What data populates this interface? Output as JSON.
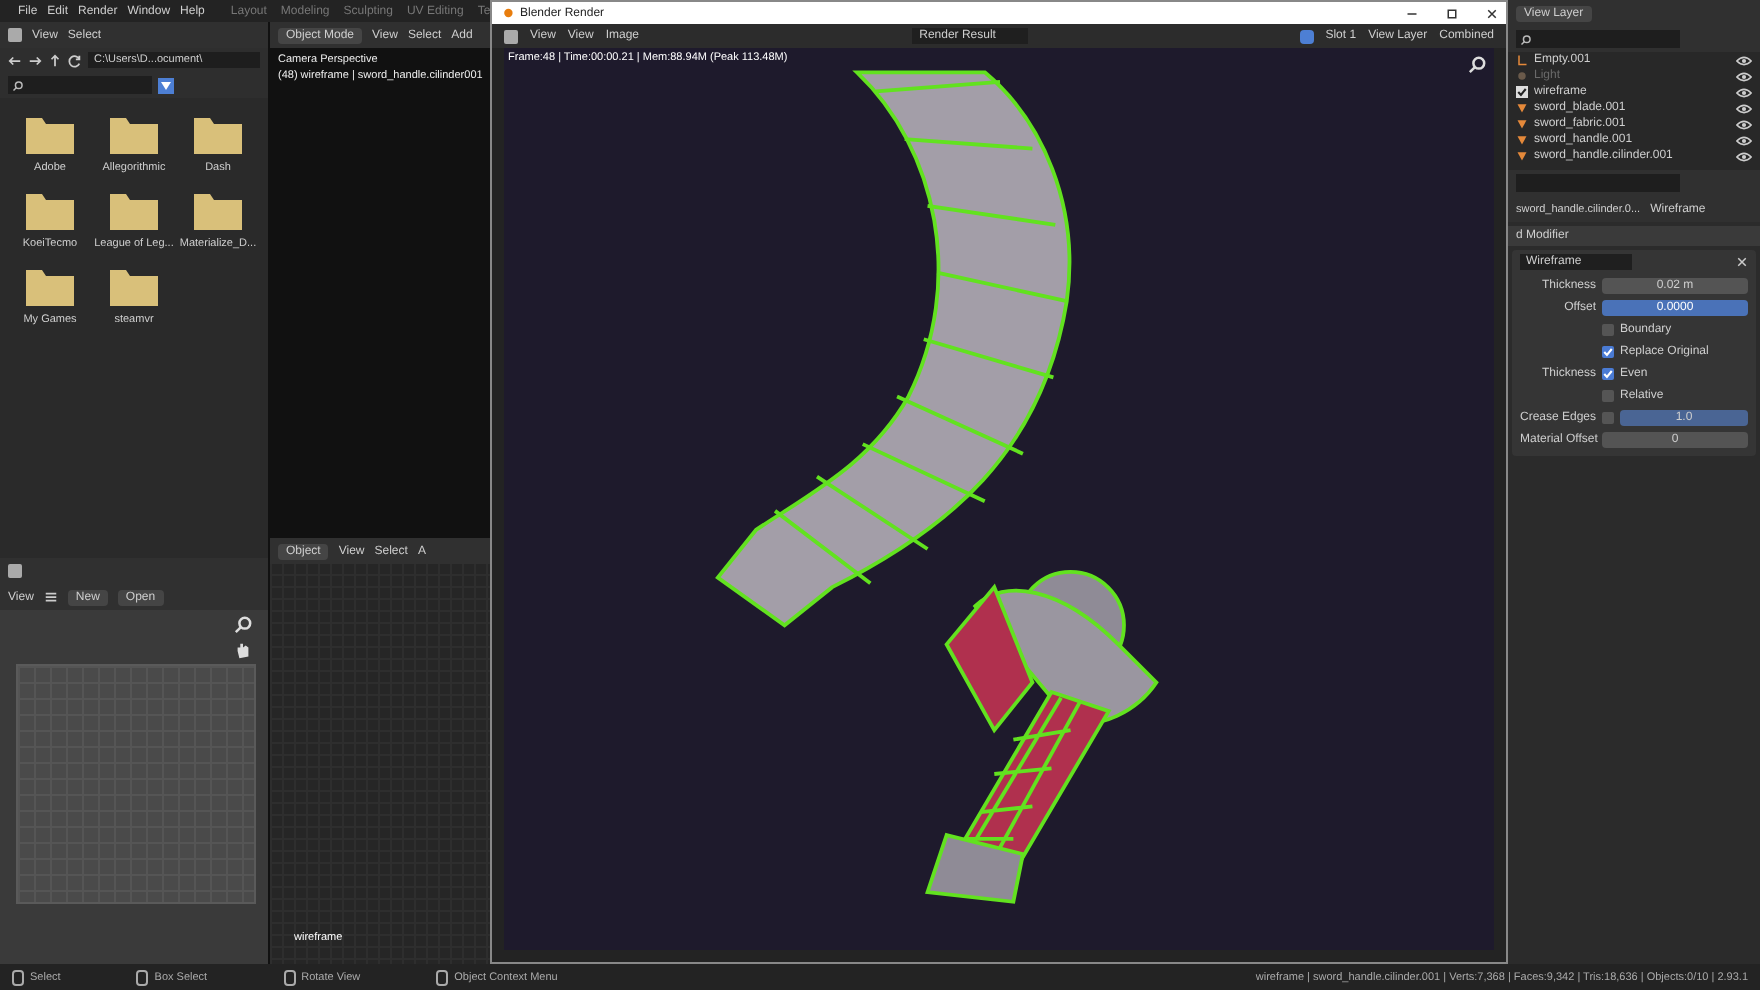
{
  "top_bar": {
    "menu": [
      "File",
      "Edit",
      "Render",
      "Window",
      "Help"
    ],
    "workspaces": [
      {
        "label": "Layout",
        "selected": false
      },
      {
        "label": "Modeling",
        "selected": false
      },
      {
        "label": "Sculpting",
        "selected": false
      },
      {
        "label": "UV Editing",
        "selected": false
      },
      {
        "label": "Te",
        "selected": false
      }
    ]
  },
  "file_browser": {
    "menu": [
      "View",
      "Select"
    ],
    "path": "C:\\Users\\D...ocument\\",
    "folders": [
      "Adobe",
      "Allegorithmic",
      "Dash",
      "KoeiTecmo",
      "League of Leg...",
      "Materialize_D...",
      "My Games",
      "steamvr"
    ]
  },
  "viewport": {
    "mode": "Object Mode",
    "menu": [
      "View",
      "Select",
      "Add"
    ],
    "overlay": [
      "Camera Perspective",
      "(48) wireframe | sword_handle.cilinder001"
    ]
  },
  "image_editor": {
    "menu": "View",
    "buttons": [
      "New",
      "Open"
    ]
  },
  "node_editor": {
    "mode": "Object",
    "menu": [
      "View",
      "Select",
      "A"
    ],
    "label": "wireframe"
  },
  "render_window": {
    "title": "Blender Render",
    "menu": [
      "View",
      "View",
      "Image"
    ],
    "image": "Render Result",
    "slot": "Slot 1",
    "layer": "View Layer",
    "pass": "Combined",
    "info": "Frame:48 | Time:00:00.21 | Mem:88.94M (Peak 113.48M)"
  },
  "outliner": {
    "header": "View Layer",
    "items": [
      {
        "kind": "empty",
        "label": "Empty.001",
        "greyed": false
      },
      {
        "kind": "light",
        "label": "Light",
        "greyed": true
      },
      {
        "kind": "collection",
        "label": "wireframe",
        "greyed": false
      },
      {
        "kind": "mesh",
        "label": "sword_blade.001",
        "greyed": false
      },
      {
        "kind": "mesh",
        "label": "sword_fabric.001",
        "greyed": false
      },
      {
        "kind": "mesh",
        "label": "sword_handle.001",
        "greyed": false
      },
      {
        "kind": "mesh",
        "label": "sword_handle.cilinder.001",
        "greyed": false
      }
    ]
  },
  "properties": {
    "object": "sword_handle.cilinder.0...",
    "modifier_tab": "Wireframe",
    "add_modifier": "d Modifier",
    "modifier_name": "Wireframe",
    "rows": [
      {
        "kind": "field",
        "label": "Thickness",
        "value": "0.02 m",
        "active": false
      },
      {
        "kind": "field",
        "label": "Offset",
        "value": "0.0000",
        "active": true
      },
      {
        "kind": "checkbox",
        "label": "",
        "text": "Boundary",
        "checked": false
      },
      {
        "kind": "checkbox",
        "label": "",
        "text": "Replace Original",
        "checked": true
      },
      {
        "kind": "checkbox",
        "label": "Thickness",
        "text": "Even",
        "checked": true
      },
      {
        "kind": "checkbox",
        "label": "",
        "text": "Relative",
        "checked": false
      },
      {
        "kind": "toggle_field",
        "label": "Crease Edges",
        "value": "1.0",
        "checked": false
      },
      {
        "kind": "field",
        "label": "Material Offset",
        "value": "0",
        "active": false
      }
    ]
  },
  "status_bar": {
    "hints": [
      "Select",
      "Box Select",
      "Rotate View",
      "Object Context Menu"
    ],
    "stats": "wireframe | sword_handle.cilinder.001 | Verts:7,368 | Faces:9,342 | Tris:18,636 | Objects:0/10 | 2.93.1"
  }
}
